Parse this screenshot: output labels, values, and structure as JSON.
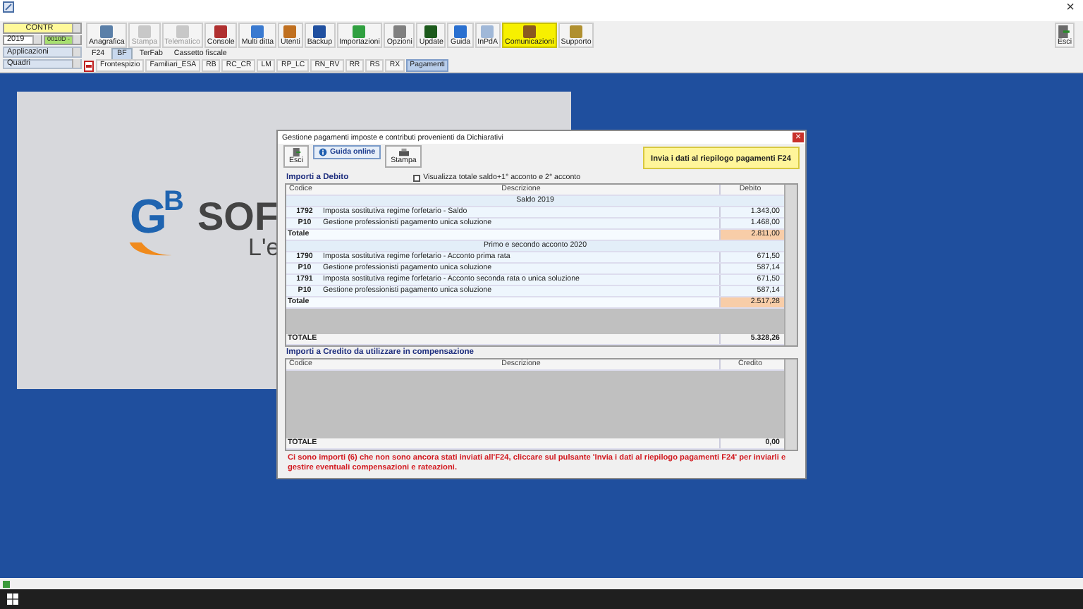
{
  "window": {
    "close": "×"
  },
  "left_panel": {
    "office": "CONTR",
    "year": "2019",
    "code": "0010D -",
    "menu_1": "Applicazioni",
    "menu_2": "Quadri"
  },
  "toolbar": [
    {
      "label": "Anagrafica",
      "disabled": false,
      "highlighted": false
    },
    {
      "label": "Stampa",
      "disabled": true,
      "highlighted": false
    },
    {
      "label": "Telematico",
      "disabled": true,
      "highlighted": false
    },
    {
      "label": "Console",
      "disabled": false,
      "highlighted": false
    },
    {
      "label": "Multi ditta",
      "disabled": false,
      "highlighted": false
    },
    {
      "label": "Utenti",
      "disabled": false,
      "highlighted": false
    },
    {
      "label": "Backup",
      "disabled": false,
      "highlighted": false
    },
    {
      "label": "Importazioni",
      "disabled": false,
      "highlighted": false
    },
    {
      "label": "Opzioni",
      "disabled": false,
      "highlighted": false
    },
    {
      "label": "Update",
      "disabled": false,
      "highlighted": false
    },
    {
      "label": "Guida",
      "disabled": false,
      "highlighted": false
    },
    {
      "label": "InPdA",
      "disabled": false,
      "highlighted": false
    },
    {
      "label": "Comunicazioni",
      "disabled": false,
      "highlighted": true
    },
    {
      "label": "Supporto",
      "disabled": false,
      "highlighted": false
    }
  ],
  "exit_button": "Esci",
  "tabs": [
    {
      "label": "F24",
      "selected": false
    },
    {
      "label": "BF",
      "selected": true
    },
    {
      "label": "TerFab",
      "selected": false
    },
    {
      "label": "Cassetto fiscale",
      "selected": false
    }
  ],
  "sections": [
    {
      "label": "Frontespizio",
      "selected": false
    },
    {
      "label": "Familiari_ESA",
      "selected": false
    },
    {
      "label": "RB",
      "selected": false
    },
    {
      "label": "RC_CR",
      "selected": false
    },
    {
      "label": "LM",
      "selected": false
    },
    {
      "label": "RP_LC",
      "selected": false
    },
    {
      "label": "RN_RV",
      "selected": false
    },
    {
      "label": "RR",
      "selected": false
    },
    {
      "label": "RS",
      "selected": false
    },
    {
      "label": "RX",
      "selected": false
    },
    {
      "label": "Pagamenti",
      "selected": true
    }
  ],
  "logo": {
    "mark_1": "G",
    "mark_2": "B",
    "word": "SOF",
    "tagline": "L'e"
  },
  "dialog": {
    "title": "Gestione pagamenti imposte e contributi provenienti da Dichiarativi",
    "close": "×",
    "buttons": [
      {
        "label": "Esci"
      },
      {
        "label": "Guida online"
      },
      {
        "label": "Stampa"
      }
    ],
    "send_button": "Invia i dati al riepilogo pagamenti F24",
    "debit": {
      "title": "Importi a Debito",
      "checkbox": {
        "label": "Visualizza totale saldo+1° acconto e 2° acconto",
        "checked": false
      },
      "columns": [
        "Codice",
        "Descrizione",
        "Debito"
      ],
      "rows": [
        {
          "kind": "group",
          "text": "Saldo 2019"
        },
        {
          "kind": "item",
          "code": "1792",
          "description": "Imposta sostitutiva regime forfetario - Saldo",
          "amount": "1.343,00"
        },
        {
          "kind": "item",
          "code": "P10",
          "description": "Gestione professionisti pagamento unica soluzione",
          "amount": "1.468,00"
        },
        {
          "kind": "total",
          "label": "Totale",
          "amount": "2.811,00"
        },
        {
          "kind": "group",
          "text": "Primo e secondo acconto 2020"
        },
        {
          "kind": "item",
          "code": "1790",
          "description": "Imposta sostitutiva regime forfetario - Acconto prima rata",
          "amount": "671,50"
        },
        {
          "kind": "item",
          "code": "P10",
          "description": "Gestione professionisti pagamento unica soluzione",
          "amount": "587,14"
        },
        {
          "kind": "item",
          "code": "1791",
          "description": "Imposta sostitutiva regime forfetario - Acconto seconda rata o unica soluzione",
          "amount": "671,50"
        },
        {
          "kind": "item",
          "code": "P10",
          "description": "Gestione professionisti pagamento unica soluzione",
          "amount": "587,14"
        },
        {
          "kind": "total",
          "label": "Totale",
          "amount": "2.517,28"
        }
      ],
      "total": {
        "label": "TOTALE",
        "amount": "5.328,26"
      }
    },
    "credit": {
      "title": "Importi a Credito da utilizzare in compensazione",
      "columns": [
        "Codice",
        "Descrizione",
        "Credito"
      ],
      "total": {
        "label": "TOTALE",
        "amount": "0,00"
      }
    },
    "message": "Ci sono importi (6) che non sono ancora stati inviati all'F24, cliccare sul pulsante 'Invia i dati al riepilogo pagamenti F24' per inviarli e gestire eventuali compensazioni e rateazioni."
  }
}
